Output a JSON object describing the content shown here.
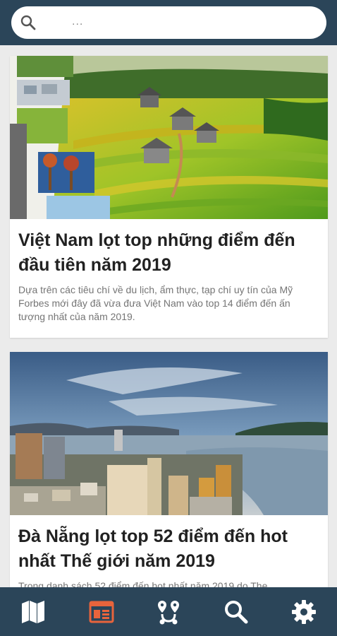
{
  "search": {
    "placeholder": "...",
    "icon": "search-icon"
  },
  "articles": [
    {
      "title": "Việt Nam lọt top những điểm đến đầu tiên năm 2019",
      "description": "Dựa trên các tiêu chí về du lịch, ẩm thực, tạp chí uy tín của Mỹ Forbes mới đây đã vừa đưa Việt Nam vào top 14 điểm đến ấn tượng nhất của năm 2019.",
      "image": "terraced-rice-fields-collage"
    },
    {
      "title": "Đà Nẵng lọt top 52 điểm đến hot nhất Thế giới năm 2019",
      "description": "Trong danh sách 52 điểm đến hot nhất năm 2019 do The",
      "image": "da-nang-city-river-aerial"
    }
  ],
  "bottom_nav": {
    "items": [
      {
        "icon": "map-icon",
        "active": false
      },
      {
        "icon": "news-icon",
        "active": true
      },
      {
        "icon": "route-icon",
        "active": false
      },
      {
        "icon": "search-icon",
        "active": false
      },
      {
        "icon": "gear-icon",
        "active": false
      }
    ]
  },
  "colors": {
    "bar": "#2b4559",
    "active": "#e8643c",
    "inactive": "#ffffff",
    "background": "#ebebeb"
  }
}
